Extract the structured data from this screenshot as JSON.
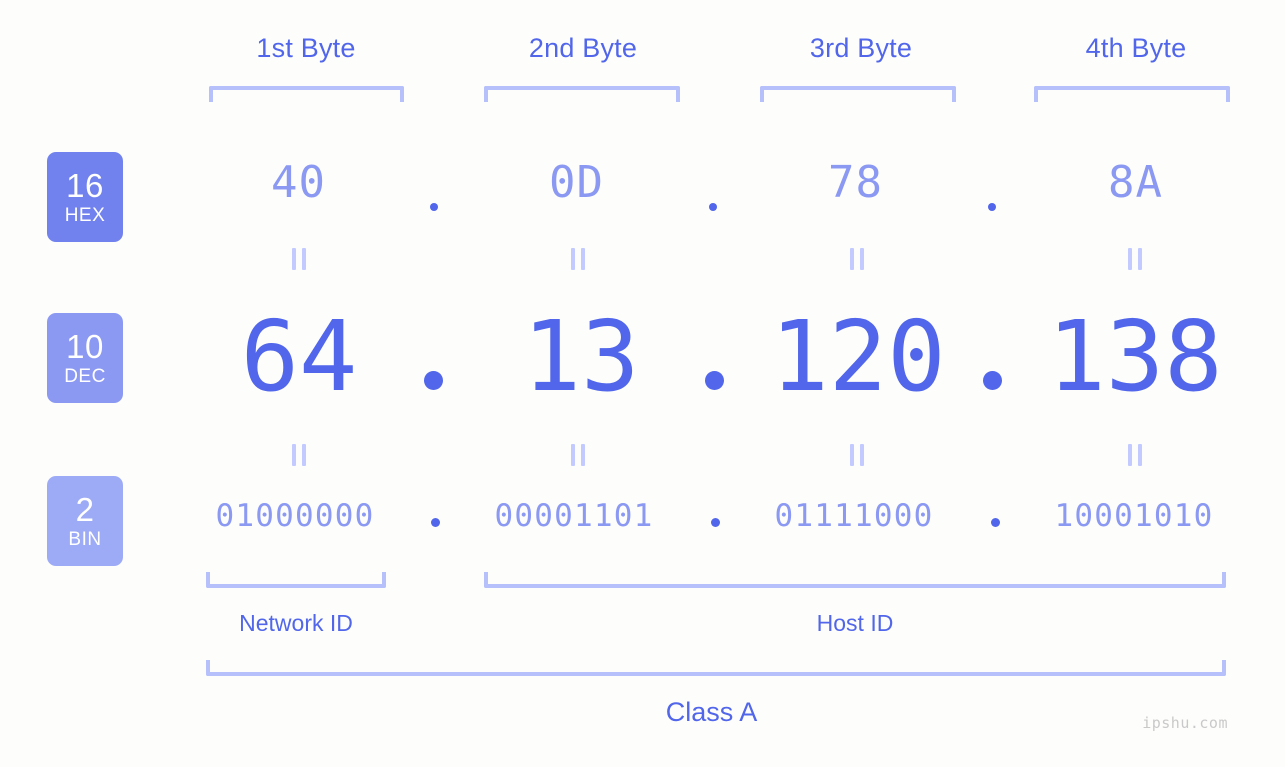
{
  "background_color": "#fdfefb",
  "colors": {
    "accent_strong": "#5166ea",
    "accent_mid": "#8b99f3",
    "accent_light": "#b6c0fb",
    "badge_hex": "#7182ee",
    "badge_dec": "#8b99f3",
    "badge_bin": "#9dabf7",
    "watermark": "#c9c9c9"
  },
  "byte_headers": [
    {
      "label": "1st Byte"
    },
    {
      "label": "2nd Byte"
    },
    {
      "label": "3rd Byte"
    },
    {
      "label": "4th Byte"
    }
  ],
  "bases": [
    {
      "number": "16",
      "name": "HEX"
    },
    {
      "number": "10",
      "name": "DEC"
    },
    {
      "number": "2",
      "name": "BIN"
    }
  ],
  "rows": {
    "hex": {
      "base_number": "16",
      "base_name": "HEX",
      "values": [
        "40",
        "0D",
        "78",
        "8A"
      ],
      "separator": "."
    },
    "dec": {
      "base_number": "10",
      "base_name": "DEC",
      "values": [
        "64",
        "13",
        "120",
        "138"
      ],
      "separator": "."
    },
    "bin": {
      "base_number": "2",
      "base_name": "BIN",
      "values": [
        "01000000",
        "00001101",
        "01111000",
        "10001010"
      ],
      "separator": "."
    }
  },
  "equality_symbol": "=",
  "segments": [
    {
      "label": "Network ID"
    },
    {
      "label": "Host ID"
    }
  ],
  "class": {
    "label": "Class A"
  },
  "watermark": {
    "text": "ipshu.com"
  }
}
